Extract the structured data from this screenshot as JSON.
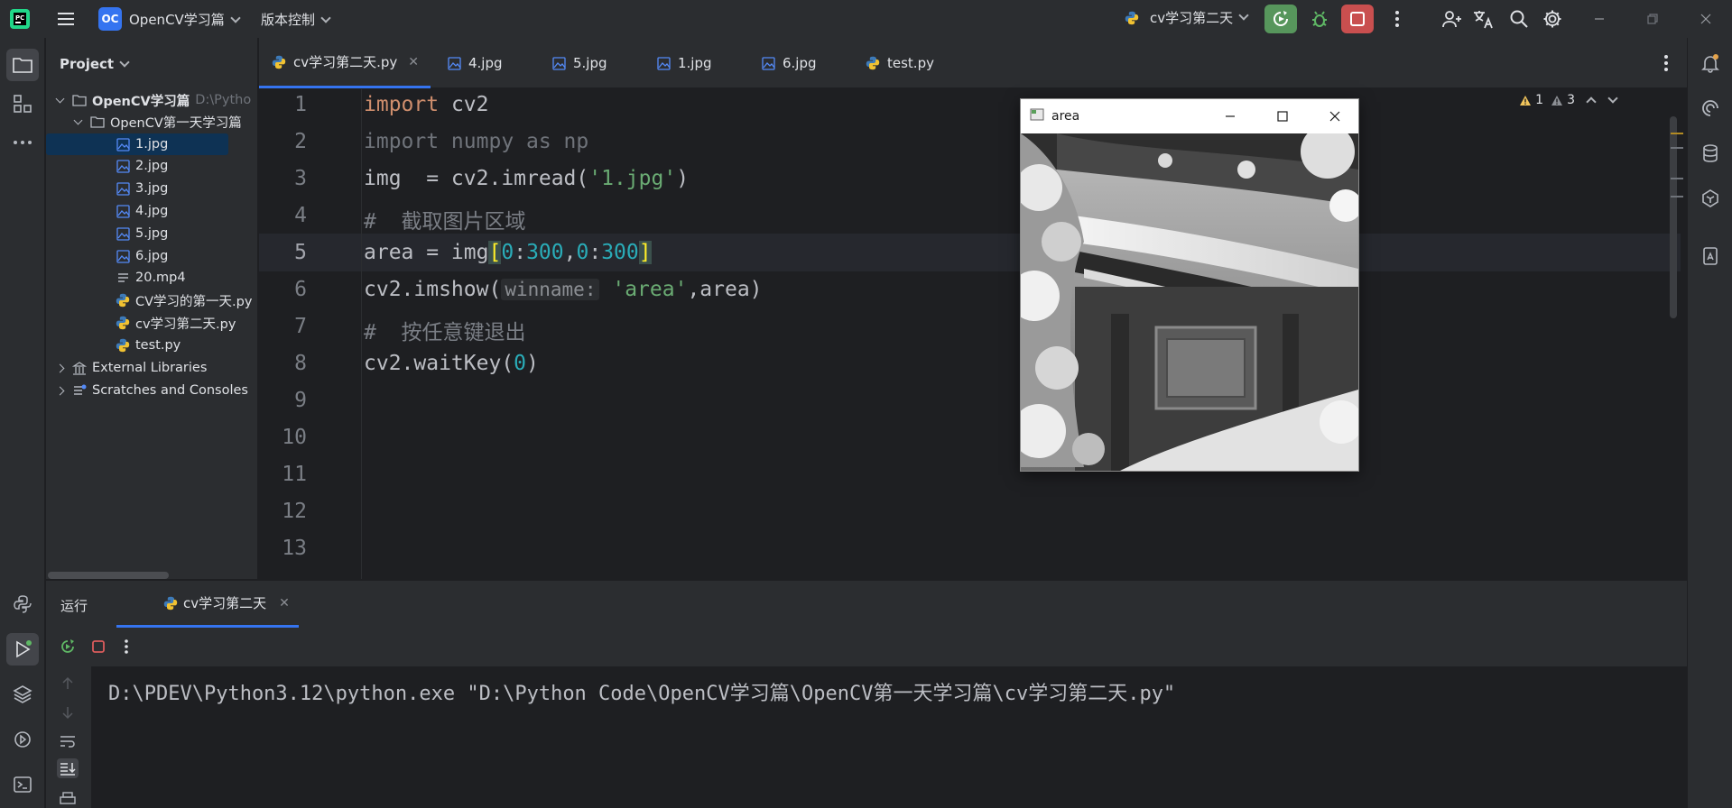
{
  "titlebar": {
    "project_badge": "OC",
    "project_name": "OpenCV学习篇",
    "vcs_label": "版本控制",
    "run_config": "cv学习第二天"
  },
  "project_panel": {
    "title": "Project",
    "root": {
      "name": "OpenCV学习篇",
      "path": "D:\\Pytho"
    },
    "folder": "OpenCV第一天学习篇",
    "files": [
      "1.jpg",
      "2.jpg",
      "3.jpg",
      "4.jpg",
      "5.jpg",
      "6.jpg",
      "20.mp4",
      "CV学习的第一天.py",
      "cv学习第二天.py",
      "test.py"
    ],
    "external": "External Libraries",
    "scratches": "Scratches and Consoles"
  },
  "tabs": [
    {
      "label": "cv学习第二天.py",
      "type": "python"
    },
    {
      "label": "4.jpg",
      "type": "image"
    },
    {
      "label": "5.jpg",
      "type": "image"
    },
    {
      "label": "1.jpg",
      "type": "image"
    },
    {
      "label": "6.jpg",
      "type": "image"
    },
    {
      "label": "test.py",
      "type": "python"
    }
  ],
  "editor": {
    "warnings": "1",
    "weak_warnings": "3",
    "line_numbers": [
      "1",
      "2",
      "3",
      "4",
      "5",
      "6",
      "7",
      "8",
      "9",
      "10",
      "11",
      "12",
      "13"
    ],
    "current_line": 5,
    "code": {
      "l1_kw": "import",
      "l1_rest": " cv2",
      "l2": "import numpy as np",
      "l3_a": "img  = cv2.imread(",
      "l3_str": "'1.jpg'",
      "l3_b": ")",
      "l4": "#  截取图片区域",
      "l5_a": "area = img",
      "l5_open": "[",
      "l5_n1": "0",
      "l5_c1": ":",
      "l5_n2": "300",
      "l5_comma": ",",
      "l5_n3": "0",
      "l5_c2": ":",
      "l5_n4": "300",
      "l5_close": "]",
      "l6_a": "cv2.imshow(",
      "l6_hint": "winname:",
      "l6_str": "'area'",
      "l6_b": ",area)",
      "l7": "#  按任意键退出",
      "l8_a": "cv2.waitKey(",
      "l8_num": "0",
      "l8_b": ")"
    }
  },
  "cv_window": {
    "title": "area"
  },
  "run_panel": {
    "label": "运行",
    "tab": "cv学习第二天",
    "console": "D:\\PDEV\\Python3.12\\python.exe \"D:\\Python Code\\OpenCV学习篇\\OpenCV第一天学习篇\\cv学习第二天.py\""
  },
  "colors": {
    "accent": "#3574f0",
    "run_green": "#57965c",
    "stop_red": "#c94f4f",
    "keyword": "#cf8e6d",
    "string": "#6aab73",
    "number": "#2aacb8"
  }
}
